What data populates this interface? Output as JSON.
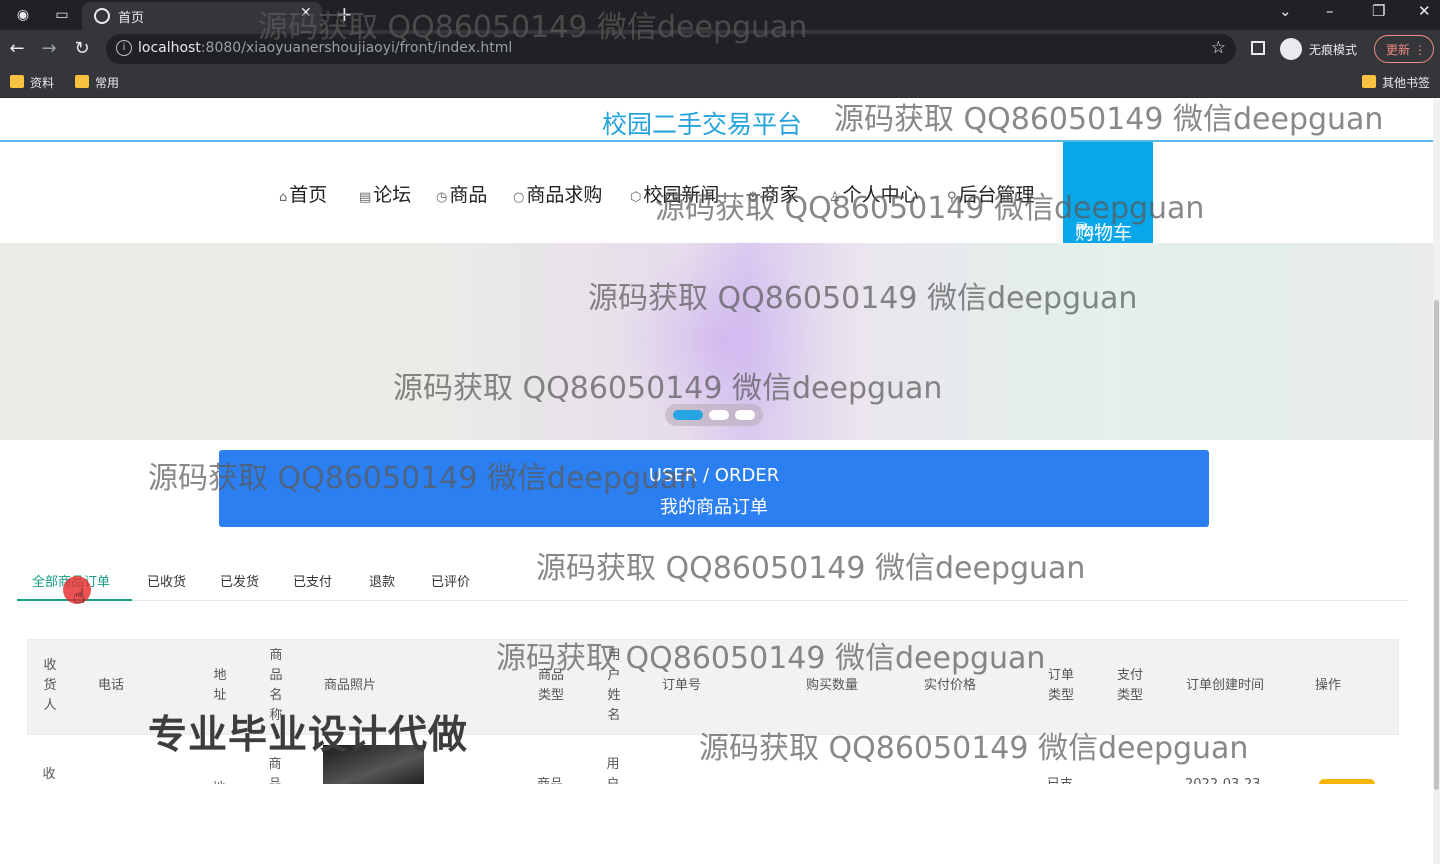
{
  "browser": {
    "tab_title": "首页",
    "url_host": "localhost",
    "url_rest": ":8080/xiaoyuanershoujiaoyi/front/index.html",
    "incognito_label": "无痕模式",
    "update_label": "更新",
    "bookmarks": [
      "资料",
      "常用"
    ],
    "other_bookmarks": "其他书签"
  },
  "site": {
    "title": "校园二手交易平台",
    "nav": [
      {
        "icon": "⌂",
        "label": "首页"
      },
      {
        "icon": "▤",
        "label": "论坛"
      },
      {
        "icon": "◷",
        "label": "商品"
      },
      {
        "icon": "○",
        "label": "商品求购"
      },
      {
        "icon": "⬡",
        "label": "校园新闻"
      },
      {
        "icon": "⚙",
        "label": "商家"
      },
      {
        "icon": "♙",
        "label": "个人中心"
      },
      {
        "icon": "⚲",
        "label": "后台管理"
      }
    ],
    "cart": {
      "icon": "⛍",
      "label": "购物车"
    }
  },
  "carousel": {
    "slides": 3,
    "active": 1
  },
  "order_banner": {
    "en": "USER / ORDER",
    "cn": "我的商品订单"
  },
  "tabs": [
    "全部商品订单",
    "已收货",
    "已发货",
    "已支付",
    "退款",
    "已评价"
  ],
  "active_tab": 0,
  "table": {
    "headers": [
      "收货人",
      "电话",
      "地址",
      "商品名称",
      "商品照片",
      "商品类型",
      "用户姓名",
      "订单号",
      "购买数量",
      "实付价格",
      "订单类型",
      "支付类型",
      "订单创建时间",
      "操作"
    ],
    "first_row_partial": {
      "consignee": "收",
      "address": "地",
      "product": "商品",
      "type": "商品",
      "user": "用户",
      "order_type": "已支",
      "created": "2022-03-23"
    }
  },
  "promo": "专业毕业设计代做",
  "watermark": "源码获取 QQ86050149 微信deepguan"
}
